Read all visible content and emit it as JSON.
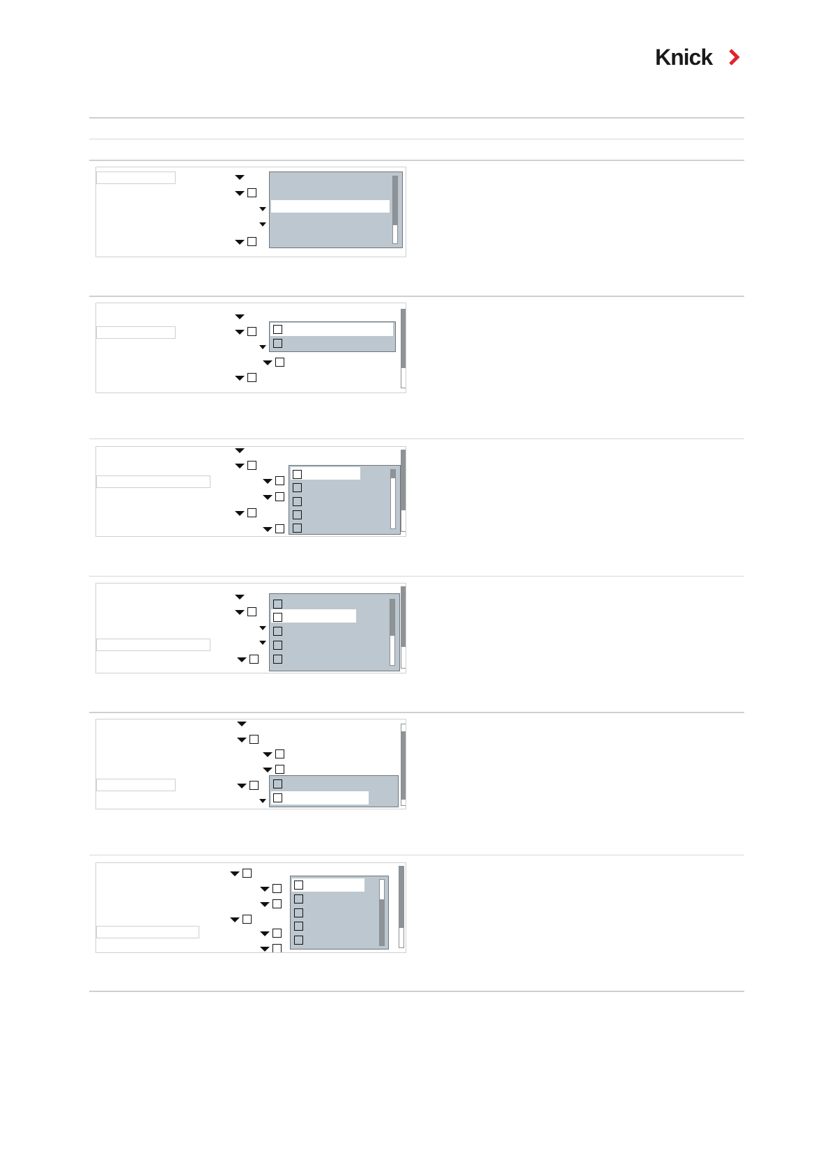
{
  "brand": {
    "logo_text": "Knick",
    "chevron_icon": "chevron-right-icon",
    "chevron_color": "#e3222b"
  },
  "colors": {
    "list_background": "#bcc7cf",
    "divider": "#cfcfcf",
    "scrollbar_thumb": "#8e9397"
  },
  "panels": [
    {
      "id": 1,
      "list_rows": 1,
      "selected_row": 1
    },
    {
      "id": 2,
      "list_rows": 2,
      "selected_row": 1
    },
    {
      "id": 3,
      "list_rows": 5,
      "selected_row": 1
    },
    {
      "id": 4,
      "list_rows": 5,
      "selected_row": 2
    },
    {
      "id": 5,
      "list_rows": 2,
      "selected_row": 2
    },
    {
      "id": 6,
      "list_rows": 5,
      "selected_row": 1
    }
  ]
}
